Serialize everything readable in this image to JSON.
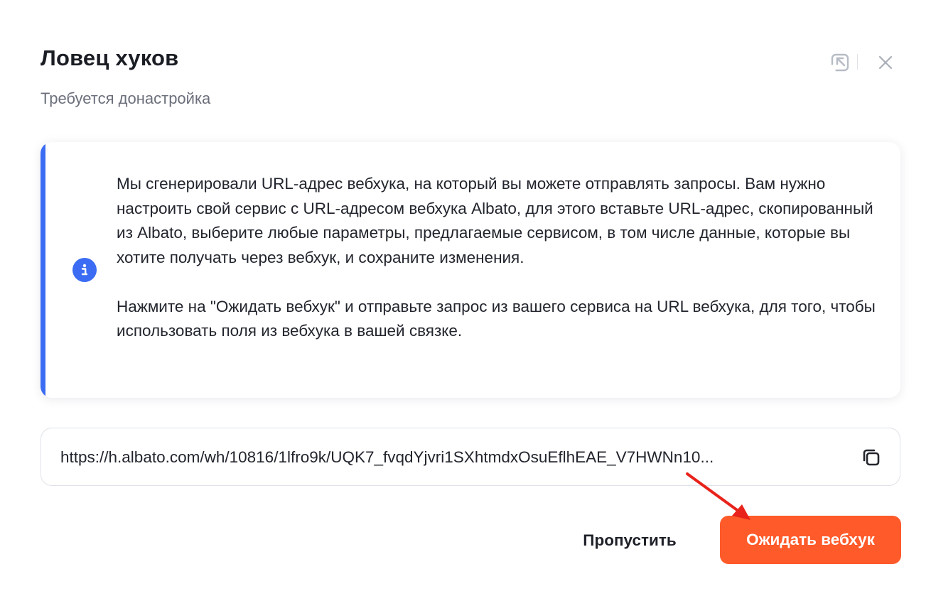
{
  "header": {
    "title": "Ловец хуков",
    "subtitle": "Требуется донастройка",
    "collapse_icon": "collapse-arrow-icon",
    "close_icon": "close-icon"
  },
  "info": {
    "icon": "info-icon",
    "paragraph1": "Мы сгенерировали URL-адрес вебхука, на который вы можете отправлять запросы. Вам нужно настроить свой сервис с URL-адресом вебхука Albato, для этого вставьте URL-адрес, скопированный из Albato, выберите любые параметры, предлагаемые сервисом, в том числе данные, которые вы хотите получать через вебхук, и сохраните изменения.",
    "paragraph2": "Нажмите на \"Ожидать вебхук\" и отправьте запрос из вашего сервиса на URL вебхука, для того, чтобы использовать поля из вебхука в вашей связке.",
    "accent_color": "#3b6cf3"
  },
  "webhook": {
    "url": "https://h.albato.com/wh/10816/1lfro9k/UQK7_fvqdYjvri1SXhtmdxOsuEflhEAE_V7HWNn10...",
    "copy_icon": "copy-icon"
  },
  "actions": {
    "skip_label": "Пропустить",
    "wait_label": "Ожидать вебхук",
    "wait_color": "#ff5a2a",
    "annotation_color": "#e8231b"
  }
}
